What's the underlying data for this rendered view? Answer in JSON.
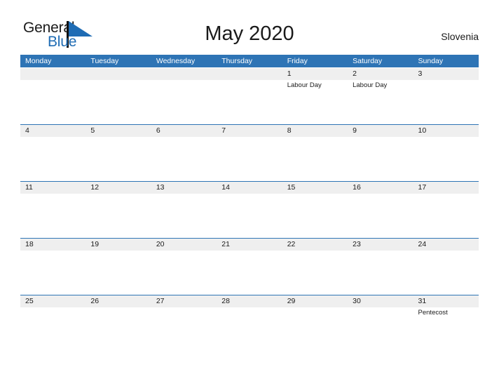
{
  "brand": {
    "name_top": "General",
    "name_bottom": "Blue",
    "accent_color": "#1f6cb4"
  },
  "header": {
    "title": "May 2020",
    "country": "Slovenia"
  },
  "theme": {
    "header_blue": "#2e74b5",
    "date_band_gray": "#efefef",
    "text_color": "#1a1a1a",
    "page_background": "#ffffff"
  },
  "calendar": {
    "weekdays": [
      "Monday",
      "Tuesday",
      "Wednesday",
      "Thursday",
      "Friday",
      "Saturday",
      "Sunday"
    ],
    "weeks": [
      [
        {
          "day": "",
          "event": ""
        },
        {
          "day": "",
          "event": ""
        },
        {
          "day": "",
          "event": ""
        },
        {
          "day": "",
          "event": ""
        },
        {
          "day": "1",
          "event": "Labour Day"
        },
        {
          "day": "2",
          "event": "Labour Day"
        },
        {
          "day": "3",
          "event": ""
        }
      ],
      [
        {
          "day": "4",
          "event": ""
        },
        {
          "day": "5",
          "event": ""
        },
        {
          "day": "6",
          "event": ""
        },
        {
          "day": "7",
          "event": ""
        },
        {
          "day": "8",
          "event": ""
        },
        {
          "day": "9",
          "event": ""
        },
        {
          "day": "10",
          "event": ""
        }
      ],
      [
        {
          "day": "11",
          "event": ""
        },
        {
          "day": "12",
          "event": ""
        },
        {
          "day": "13",
          "event": ""
        },
        {
          "day": "14",
          "event": ""
        },
        {
          "day": "15",
          "event": ""
        },
        {
          "day": "16",
          "event": ""
        },
        {
          "day": "17",
          "event": ""
        }
      ],
      [
        {
          "day": "18",
          "event": ""
        },
        {
          "day": "19",
          "event": ""
        },
        {
          "day": "20",
          "event": ""
        },
        {
          "day": "21",
          "event": ""
        },
        {
          "day": "22",
          "event": ""
        },
        {
          "day": "23",
          "event": ""
        },
        {
          "day": "24",
          "event": ""
        }
      ],
      [
        {
          "day": "25",
          "event": ""
        },
        {
          "day": "26",
          "event": ""
        },
        {
          "day": "27",
          "event": ""
        },
        {
          "day": "28",
          "event": ""
        },
        {
          "day": "29",
          "event": ""
        },
        {
          "day": "30",
          "event": ""
        },
        {
          "day": "31",
          "event": "Pentecost"
        }
      ]
    ]
  }
}
